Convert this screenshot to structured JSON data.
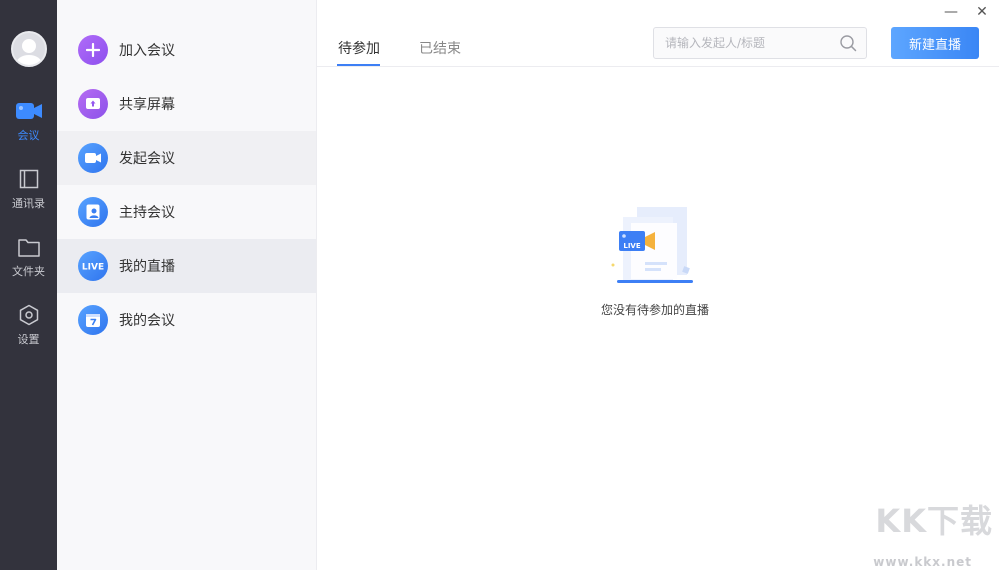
{
  "rail": {
    "items": [
      {
        "label": "会议",
        "icon": "camera-icon",
        "active": true
      },
      {
        "label": "通讯录",
        "icon": "contacts-icon"
      },
      {
        "label": "文件夹",
        "icon": "folder-icon"
      },
      {
        "label": "设置",
        "icon": "hexagon-settings-icon"
      }
    ]
  },
  "menu": {
    "items": [
      {
        "label": "加入会议",
        "icon": "plus-icon",
        "color": "#9b5cf6"
      },
      {
        "label": "共享屏幕",
        "icon": "share-screen-icon",
        "color": "#a15cf0"
      },
      {
        "label": "发起会议",
        "icon": "video-camera-icon",
        "color": "#3d88f7"
      },
      {
        "label": "主持会议",
        "icon": "host-icon",
        "color": "#3d88f7"
      },
      {
        "label": "我的直播",
        "icon": "live-icon",
        "color": "#3d88f7"
      },
      {
        "label": "我的会议",
        "icon": "calendar-icon",
        "color": "#3d88f7"
      }
    ]
  },
  "main": {
    "tabs": [
      {
        "label": "待参加",
        "active": true
      },
      {
        "label": "已结束"
      }
    ],
    "search_placeholder": "请输入发起人/标题",
    "new_live_label": "新建直播",
    "empty_badge": "LIVE",
    "empty_text": "您没有待参加的直播"
  },
  "window": {
    "minimize": "—",
    "close": "✕"
  },
  "watermark": {
    "title": "KK下载",
    "url": "www.kkx.net"
  },
  "colors": {
    "accent": "#3d7ff5",
    "rail_bg": "#33333d",
    "menu_bg": "#f8f8fa"
  }
}
